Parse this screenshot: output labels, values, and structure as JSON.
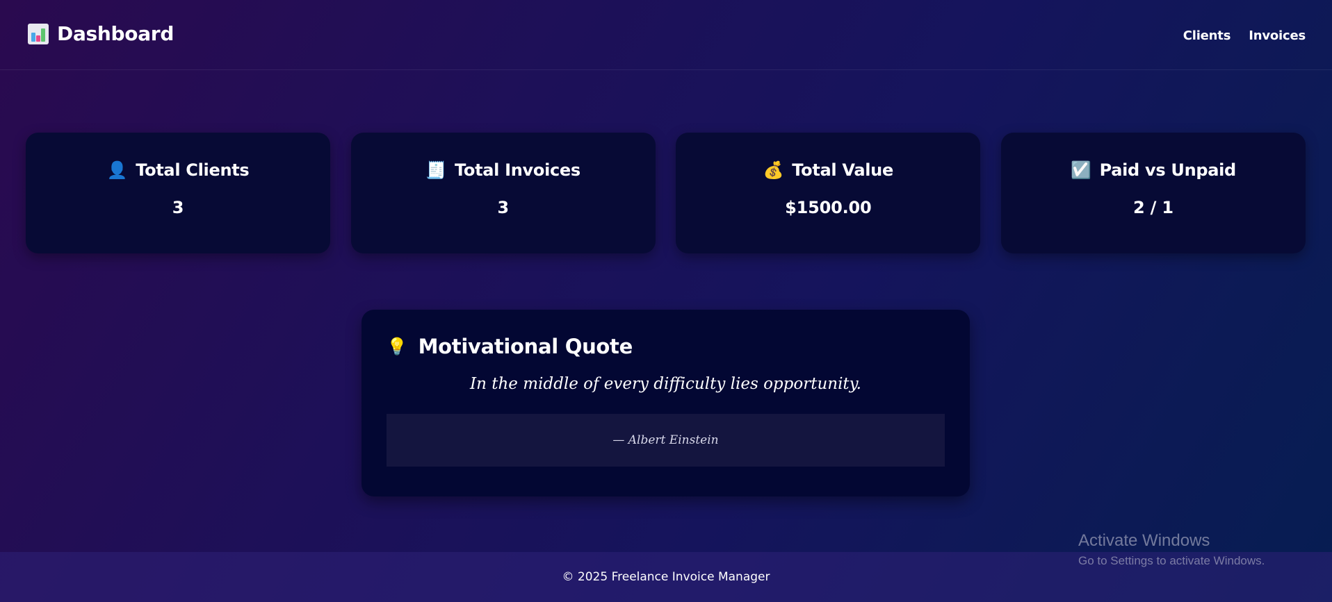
{
  "header": {
    "title": "Dashboard",
    "icon": "bar-chart-icon",
    "nav": [
      {
        "label": "Clients"
      },
      {
        "label": "Invoices"
      }
    ]
  },
  "stats": [
    {
      "icon": "person-icon",
      "emoji": "👤",
      "title": "Total Clients",
      "value": "3"
    },
    {
      "icon": "receipt-icon",
      "emoji": "🧾",
      "title": "Total Invoices",
      "value": "3"
    },
    {
      "icon": "money-bag-icon",
      "emoji": "💰",
      "title": "Total Value",
      "value": "$1500.00"
    },
    {
      "icon": "check-box-icon",
      "emoji": "☑️",
      "title": "Paid vs Unpaid",
      "value": "2 / 1"
    }
  ],
  "quote": {
    "icon": "light-bulb-icon",
    "emoji": "💡",
    "heading": "Motivational Quote",
    "text": "In the middle of every difficulty lies opportunity.",
    "author": "— Albert Einstein"
  },
  "footer": {
    "text": "© 2025 Freelance Invoice Manager"
  },
  "watermark": {
    "title": "Activate Windows",
    "subtitle": "Go to Settings to activate Windows."
  },
  "colors": {
    "card_bg": "#070a35",
    "quote_bg": "#030733",
    "author_box_bg": "#14153f",
    "gradient_start": "#2a0a4f",
    "gradient_end": "#061d52"
  }
}
